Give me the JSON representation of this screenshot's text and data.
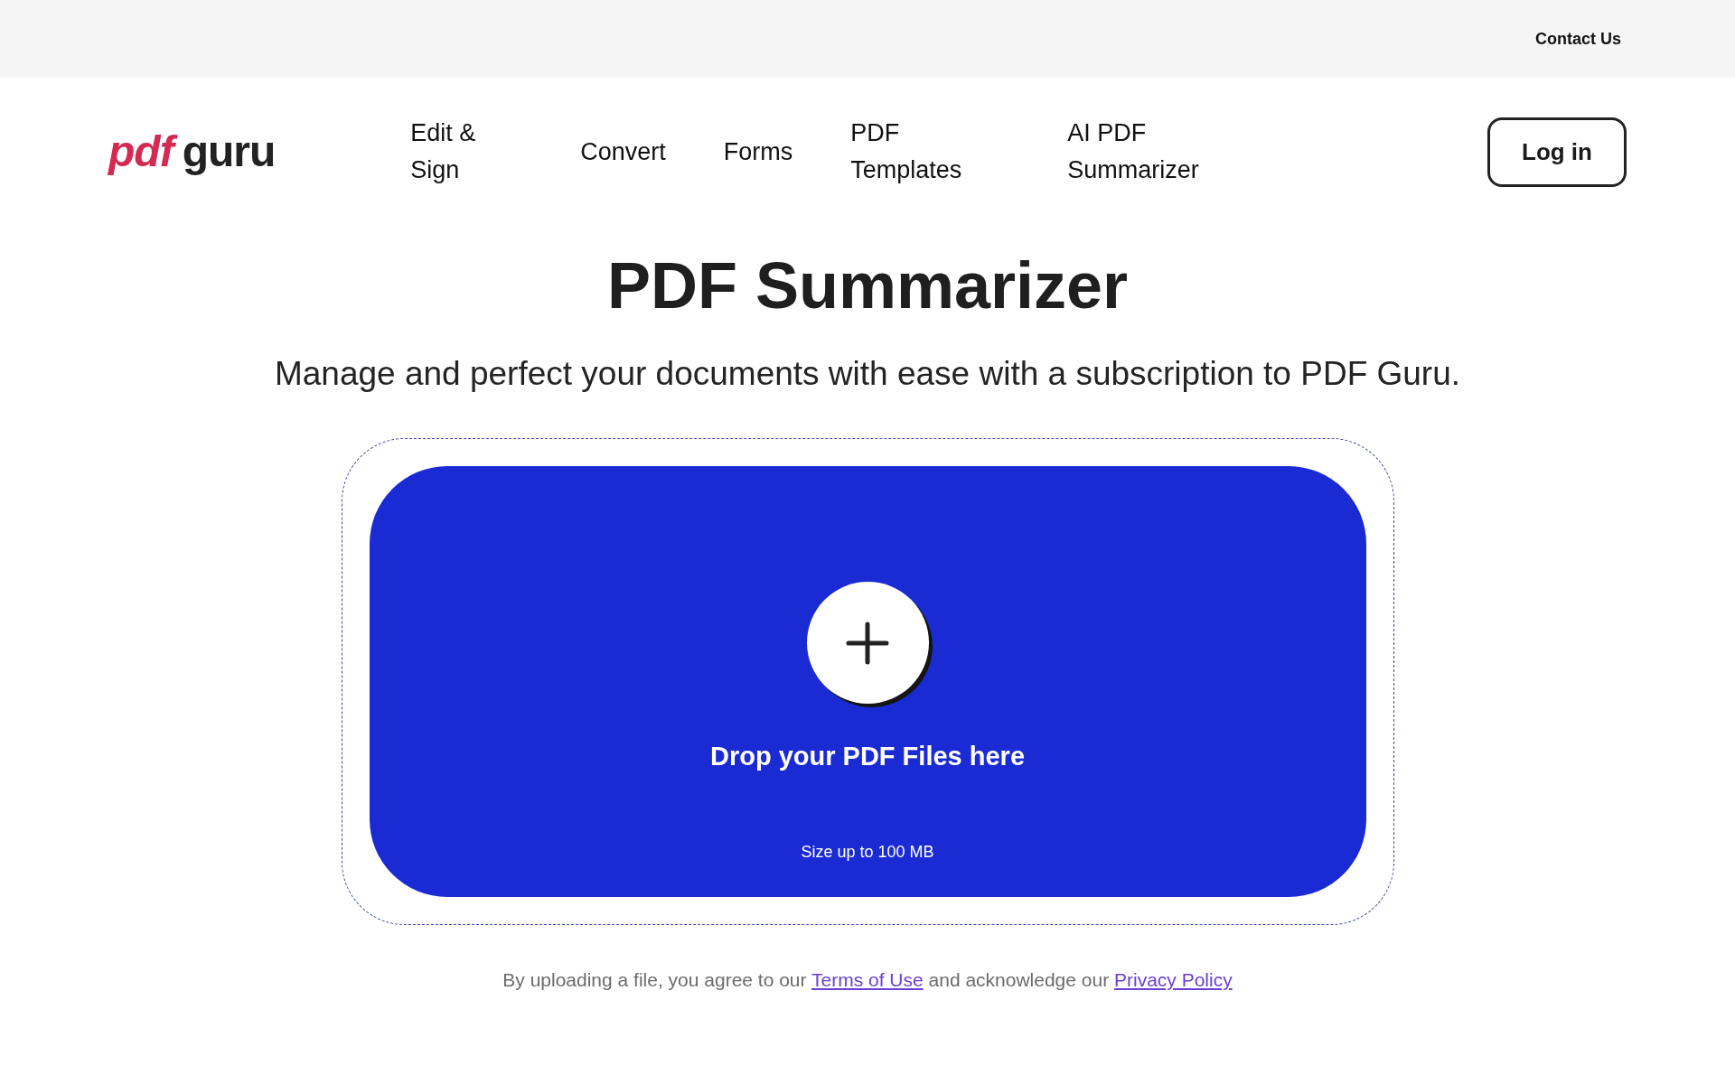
{
  "top_bar": {
    "links": [
      "Contact Us"
    ]
  },
  "header": {
    "logo": {
      "prefix": "pdf",
      "name": "guru"
    },
    "nav": [
      "Edit & Sign",
      "Convert",
      "Forms",
      "PDF Templates",
      "AI PDF Summarizer"
    ],
    "login_button": "Log in"
  },
  "hero": {
    "title": "PDF Summarizer",
    "subtitle": "Manage and perfect your documents with ease with a subscription to PDF Guru."
  },
  "upload": {
    "drop_text": "Drop your PDF Files here",
    "size_note": "Size up to 100 MB"
  },
  "consent": {
    "text_before": "By uploading a file, you agree to our",
    "terms_link": "Terms of Use",
    "text_middle": "and acknowledge our",
    "privacy_link": "Privacy Policy"
  }
}
